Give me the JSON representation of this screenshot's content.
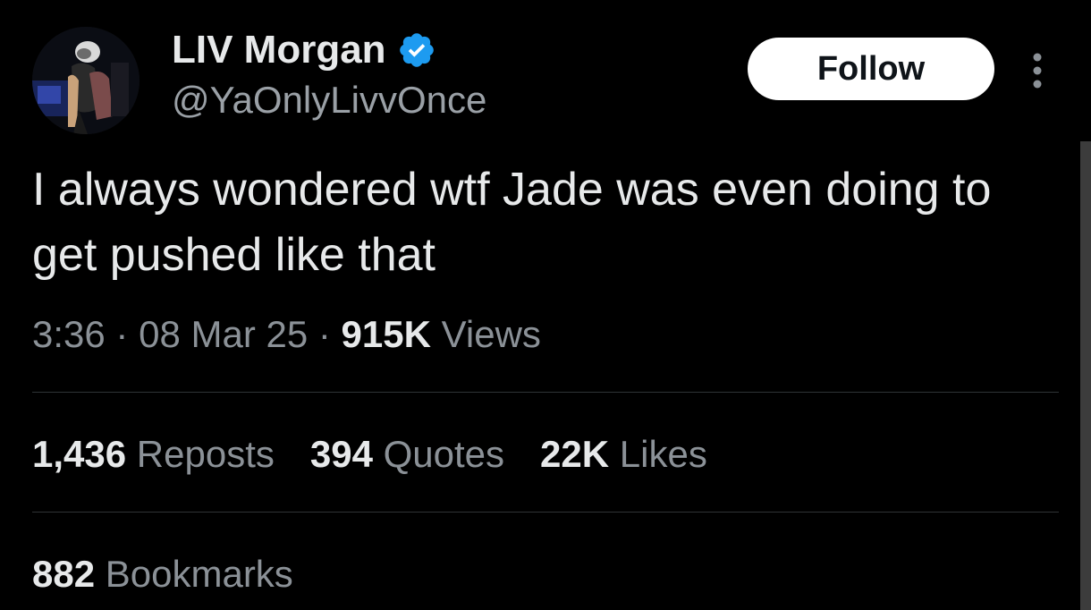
{
  "author": {
    "display_name": "LIV Morgan",
    "handle": "@YaOnlyLivvOnce",
    "verified": true,
    "verified_color": "#1d9bf0"
  },
  "actions": {
    "follow_label": "Follow",
    "more_icon": "more-vertical-icon"
  },
  "tweet": {
    "text": "I always wondered wtf Jade was even doing to get pushed like that"
  },
  "meta": {
    "time": "3:36",
    "separator": "·",
    "date": "08 Mar 25",
    "views_count": "915K",
    "views_label": "Views"
  },
  "stats": {
    "reposts_count": "1,436",
    "reposts_label": "Reposts",
    "quotes_count": "394",
    "quotes_label": "Quotes",
    "likes_count": "22K",
    "likes_label": "Likes",
    "bookmarks_count": "882",
    "bookmarks_label": "Bookmarks"
  },
  "colors": {
    "background": "#000000",
    "primary_text": "#e7e9ea",
    "secondary_text": "#8b9197",
    "divider": "#2f3336",
    "follow_bg": "#ffffff"
  }
}
